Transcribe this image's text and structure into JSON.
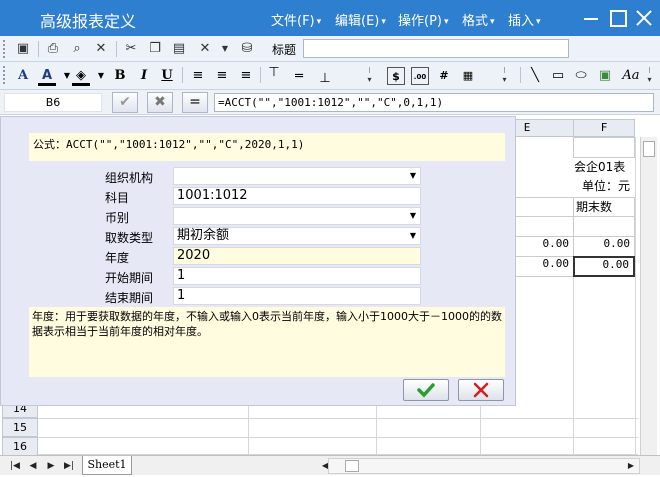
{
  "window": {
    "title": "高级报表定义",
    "menus": [
      "文件(F)",
      "编辑(E)",
      "操作(P)",
      "格式",
      "插入"
    ]
  },
  "toolbar": {
    "title_label": "标题",
    "title_value": ""
  },
  "formula_bar": {
    "cell_ref": "B6",
    "formula": "=ACCT(\"\",\"1001:1012\",\"\",\"C\",0,1,1)"
  },
  "sheet": {
    "columns": [
      "E",
      "F"
    ],
    "rows": [
      "14",
      "15",
      "16"
    ],
    "cells": {
      "f_company": "会企01表",
      "f_unit": "单位：元",
      "f_header": "期末数",
      "e_val1": "0.00",
      "f_val1": "0.00",
      "e_val2": "0.00",
      "f_val2": "0.00"
    },
    "tab_name": "Sheet1"
  },
  "dialog": {
    "formula_text": "公式：ACCT(\"\",\"1001:1012\",\"\",\"C\",2020,1,1)",
    "fields": [
      {
        "label": "组织机构",
        "value": "",
        "type": "select"
      },
      {
        "label": "科目",
        "value": "1001:1012",
        "type": "text"
      },
      {
        "label": "币别",
        "value": "",
        "type": "select"
      },
      {
        "label": "取数类型",
        "value": "期初余额",
        "type": "select"
      },
      {
        "label": "年度",
        "value": "2020",
        "type": "text"
      },
      {
        "label": "开始期间",
        "value": "1",
        "type": "text"
      },
      {
        "label": "结束期间",
        "value": "1",
        "type": "text"
      }
    ],
    "help_text": "年度：用于要获取数据的年度，不输入或输入0表示当前年度，输入小于1000大于－1000的的数据表示相当于当前年度的相对年度。",
    "colors": {
      "ok": "#2e9b2e",
      "cancel": "#d02020",
      "accent": "#2f7fd0"
    }
  },
  "icons": [
    "save-icon",
    "print-icon",
    "print-preview-icon",
    "tools-icon",
    "cut-icon",
    "copy-icon",
    "paste-icon",
    "format-painter-icon",
    "database-icon",
    "font-icon",
    "font-color-icon",
    "fill-color-icon",
    "bold-icon",
    "italic-icon",
    "underline-icon",
    "align-left-icon",
    "align-center-icon",
    "align-right-icon",
    "currency-icon",
    "decimal-icon",
    "line-icon",
    "rectangle-icon",
    "ellipse-icon",
    "image-icon",
    "text-style-icon"
  ]
}
